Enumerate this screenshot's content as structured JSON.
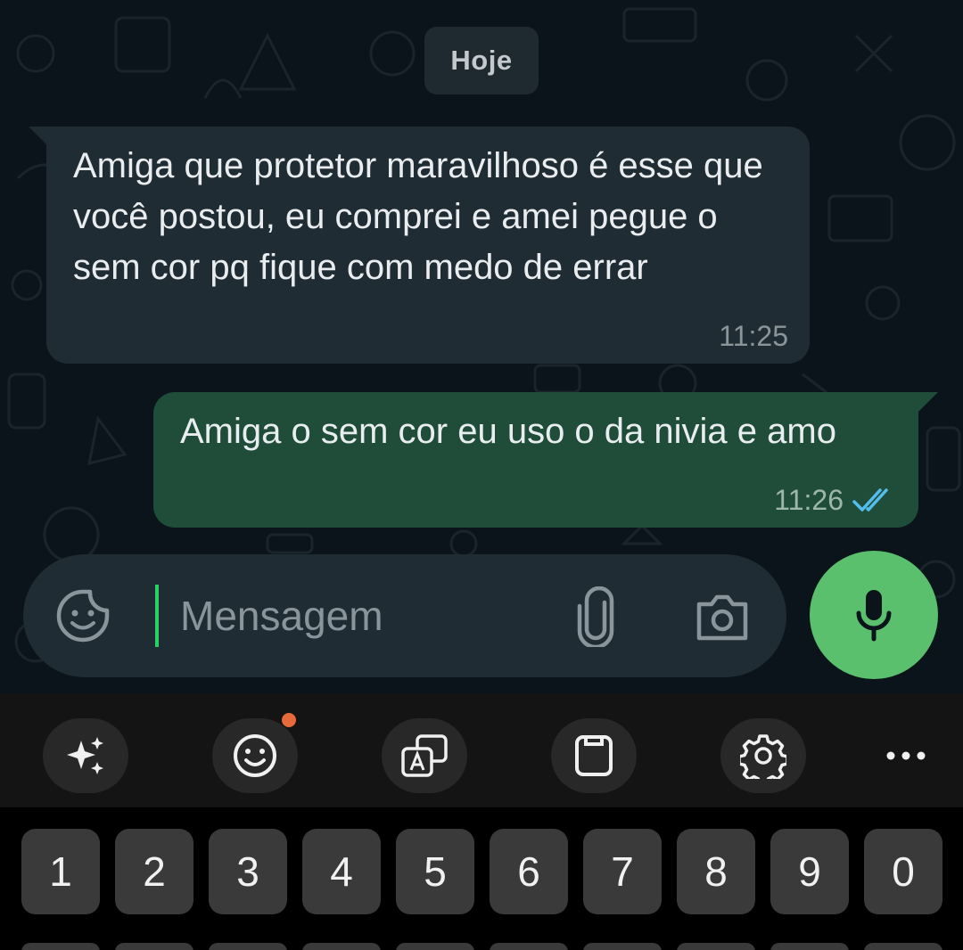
{
  "chat": {
    "date_chip": "Hoje",
    "messages": [
      {
        "direction": "incoming",
        "text": "Amiga que protetor maravilhoso é esse que você postou, eu comprei e amei pegue o sem cor pq fique com medo de errar",
        "time": "11:25"
      },
      {
        "direction": "outgoing",
        "text": "Amiga o sem cor eu uso o da nivia e amo",
        "time": "11:26",
        "status": "read",
        "status_icon": "double-check-icon"
      }
    ]
  },
  "composer": {
    "placeholder": "Mensagem",
    "emoji_icon": "sticker-icon",
    "attach_icon": "paperclip-icon",
    "camera_icon": "camera-icon",
    "mic_icon": "microphone-icon"
  },
  "keyboard_toolbar": {
    "tools": [
      "sparkles-icon",
      "emoji-icon",
      "translate-icon",
      "clipboard-icon",
      "gear-icon",
      "more-icon"
    ]
  },
  "keyboard": {
    "number_row": [
      "1",
      "2",
      "3",
      "4",
      "5",
      "6",
      "7",
      "8",
      "9",
      "0"
    ]
  },
  "colors": {
    "chat_bg": "#0b141a",
    "incoming_bubble": "#202c33",
    "outgoing_bubble": "#1f4d3a",
    "accent_green": "#5ac06d",
    "read_ticks": "#53bdeb"
  }
}
